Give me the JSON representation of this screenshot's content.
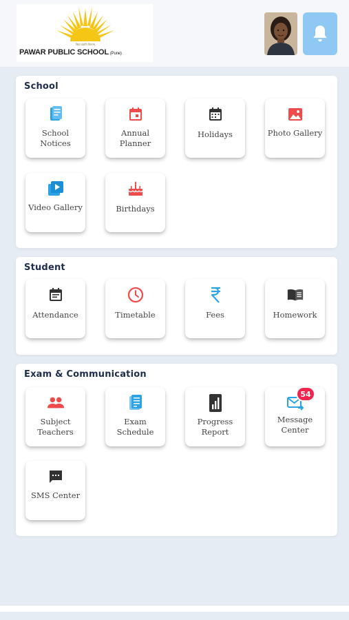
{
  "header": {
    "school_name": "PAWAR PUBLIC SCHOOL",
    "school_suffix": "(Pune)",
    "tagline": "विद्या ददाति विनयम्",
    "colors": {
      "bell_button": "#8fc8f3",
      "logo_sun": "#f6c616"
    }
  },
  "sections": {
    "school": {
      "title": "School",
      "items": [
        {
          "label": "School Notices",
          "icon": "notices-icon",
          "color": "#2ca3e6"
        },
        {
          "label": "Annual Planner",
          "icon": "calendar-icon",
          "color": "#ef4b4b"
        },
        {
          "label": "Holidays",
          "icon": "calendar-grid-icon",
          "color": "#333333"
        },
        {
          "label": "Photo Gallery",
          "icon": "photo-icon",
          "color": "#ef4b4b"
        },
        {
          "label": "Video Gallery",
          "icon": "video-icon",
          "color": "#2ca3e6"
        },
        {
          "label": "Birthdays",
          "icon": "cake-icon",
          "color": "#ef4b4b"
        }
      ]
    },
    "student": {
      "title": "Student",
      "items": [
        {
          "label": "Attendance",
          "icon": "attendance-icon",
          "color": "#333333"
        },
        {
          "label": "Timetable",
          "icon": "clock-icon",
          "color": "#ef4b4b"
        },
        {
          "label": "Fees",
          "icon": "rupee-icon",
          "color": "#2ca3e6"
        },
        {
          "label": "Homework",
          "icon": "book-icon",
          "color": "#333333"
        }
      ]
    },
    "exam": {
      "title": "Exam & Communication",
      "items": [
        {
          "label": "Subject Teachers",
          "icon": "people-icon",
          "color": "#ef4b4b"
        },
        {
          "label": "Exam Schedule",
          "icon": "schedule-icon",
          "color": "#2ca3e6"
        },
        {
          "label": "Progress Report",
          "icon": "report-icon",
          "color": "#333333"
        },
        {
          "label": "Message Center",
          "icon": "message-icon",
          "color": "#2ca3e6",
          "badge": "54"
        },
        {
          "label": "SMS Center",
          "icon": "sms-icon",
          "color": "#333333"
        }
      ]
    }
  }
}
